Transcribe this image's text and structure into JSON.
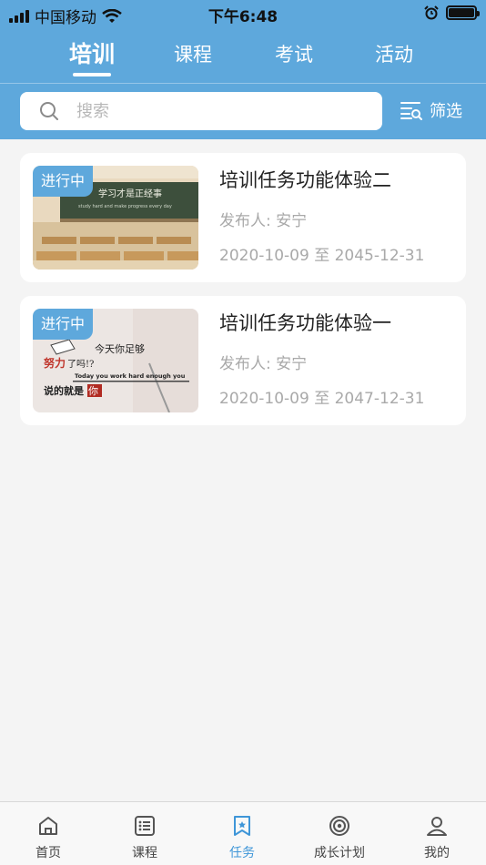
{
  "status_bar": {
    "carrier": "中国移动",
    "time": "下午6:48"
  },
  "top_tabs": [
    {
      "label": "培训",
      "active": true
    },
    {
      "label": "课程",
      "active": false
    },
    {
      "label": "考试",
      "active": false
    },
    {
      "label": "活动",
      "active": false
    }
  ],
  "search": {
    "placeholder": "搜索",
    "value": ""
  },
  "filter": {
    "label": "筛选",
    "icon": "filter-icon"
  },
  "cards": [
    {
      "badge": "进行中",
      "title": "培训任务功能体验二",
      "publisher": "发布人: 安宁",
      "dates": "2020-10-09 至 2045-12-31",
      "image": {
        "type": "classroom-chalkboard",
        "board_text": "学习才是正经事",
        "board_subtext": "study hard and make progress every day"
      }
    },
    {
      "badge": "进行中",
      "title": "培训任务功能体验一",
      "publisher": "发布人: 安宁",
      "dates": "2020-10-09 至 2047-12-31",
      "image": {
        "type": "motivational-poster",
        "line1": "今天你足够",
        "line2a": "努力",
        "line2b": "了吗!?",
        "line3": "Today you work hard enough you",
        "line4a": "说的就是",
        "line4b": "你"
      }
    }
  ],
  "tabbar": [
    {
      "label": "首页",
      "icon": "home-icon",
      "active": false
    },
    {
      "label": "课程",
      "icon": "course-list-icon",
      "active": false
    },
    {
      "label": "任务",
      "icon": "task-bookmark-icon",
      "active": true
    },
    {
      "label": "成长计划",
      "icon": "target-icon",
      "active": false
    },
    {
      "label": "我的",
      "icon": "profile-icon",
      "active": false
    }
  ],
  "colors": {
    "primary": "#5ea8dc",
    "active_tab": "#3f96d8",
    "background": "#f4f4f4"
  }
}
